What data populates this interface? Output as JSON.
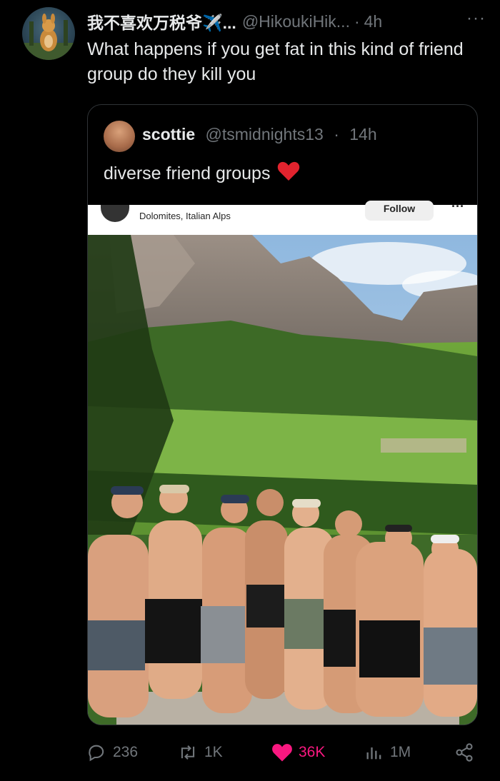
{
  "tweet": {
    "author_name": "我不喜欢万税爷✈️...",
    "author_handle": "@HikoukiHik...",
    "separator": "·",
    "time": "4h",
    "more": "···",
    "text": "What happens if you get fat in this kind of friend group do they kill you"
  },
  "quote": {
    "author_name": "scottie",
    "author_handle": "@tsmidnights13",
    "separator": "·",
    "time": "14h",
    "text": "diverse friend groups",
    "embedded_post": {
      "location": "Dolomites, Italian Alps",
      "follow_label": "Follow",
      "more": "···"
    }
  },
  "stats": {
    "replies": "236",
    "reposts": "1K",
    "likes": "36K",
    "views": "1M"
  },
  "colors": {
    "background": "#000000",
    "text": "#e7e9ea",
    "muted": "#71767b",
    "like_pink": "#f91880",
    "border": "#2f3336"
  }
}
